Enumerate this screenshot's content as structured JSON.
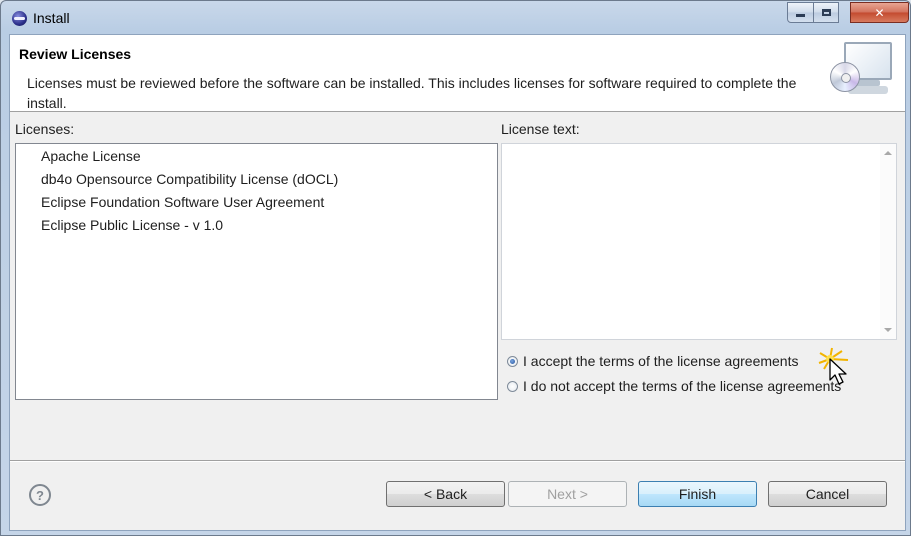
{
  "window": {
    "title": "Install",
    "controls": {
      "minimize": "minimize",
      "maximize": "maximize",
      "close": "✕"
    }
  },
  "header": {
    "title": "Review Licenses",
    "description": "Licenses must be reviewed before the software can be installed.  This includes licenses for software required to complete the install.",
    "icon": "install-cd-monitor-icon"
  },
  "licenses": {
    "label": "Licenses:",
    "items": [
      "Apache License",
      "db4o Opensource Compatibility License (dOCL)",
      "Eclipse Foundation Software User Agreement",
      "Eclipse Public License - v 1.0"
    ]
  },
  "license_text": {
    "label": "License text:",
    "value": ""
  },
  "acceptance": {
    "options": [
      {
        "label": "I accept the terms of the license agreements",
        "checked": true
      },
      {
        "label": "I do not accept the terms of the license agreements",
        "checked": false
      }
    ]
  },
  "footer": {
    "help": "?",
    "back": "< Back",
    "next": "Next >",
    "finish": "Finish",
    "cancel": "Cancel"
  }
}
